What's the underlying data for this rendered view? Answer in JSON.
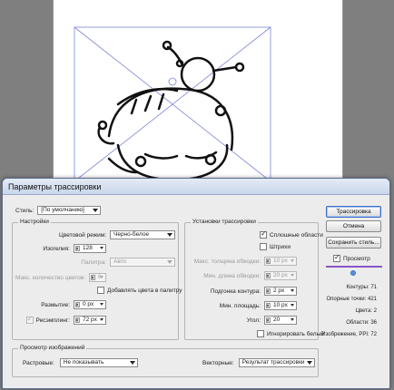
{
  "dialog": {
    "title": "Параметры трассировки"
  },
  "style": {
    "label": "Стиль:",
    "value": "[По умолчанию]"
  },
  "settings": {
    "title": "Настройки",
    "color_mode": {
      "label": "Цветовой режим:",
      "value": "Черно-белое"
    },
    "threshold": {
      "label": "Изогелия:",
      "value": "128"
    },
    "palette": {
      "label": "Палитра:",
      "value": "Авто"
    },
    "max_colors": {
      "label": "Макс. количество цветов:",
      "value": "6"
    },
    "add_swatches": {
      "label": "Добавлять цвета в палитру",
      "checked": false
    },
    "blur": {
      "label": "Размытие:",
      "value": "0 px"
    },
    "resample": {
      "label": "Ресэмплинг:",
      "value": "72 px",
      "checked": true
    }
  },
  "trace": {
    "title": "Установки трассировки",
    "fills": {
      "label": "Сплошные области",
      "checked": true
    },
    "strokes": {
      "label": "Штрихи",
      "checked": false
    },
    "max_stroke_weight": {
      "label": "Макс. толщина обводки:",
      "value": "10 px"
    },
    "min_stroke_length": {
      "label": "Мин. длина обводки:",
      "value": "20 px"
    },
    "path_fitting": {
      "label": "Подгонка контура:",
      "value": "2 px"
    },
    "min_area": {
      "label": "Мин. площадь:",
      "value": "10 px"
    },
    "corner_angle": {
      "label": "Угол:",
      "value": "20"
    },
    "ignore_white": {
      "label": "Игнорировать белый",
      "checked": false
    }
  },
  "view": {
    "title": "Просмотр изображений",
    "raster_label": "Растровые:",
    "raster_value": "Не показывать",
    "vector_label": "Векторные:",
    "vector_value": "Результат трассировки"
  },
  "buttons": {
    "trace": "Трассировка",
    "cancel": "Отмена",
    "save_preset": "Сохранить стиль..."
  },
  "preview": {
    "label": "Просмотр",
    "checked": true
  },
  "stats": [
    "Контуры: 71",
    "Опорные точки: 421",
    "Цвета: 2",
    "Области: 36",
    "Изобрежение, PPI: 72"
  ],
  "colors": {
    "accent": "#3a6ec8",
    "preview_bar": "#8a55c8",
    "selection_lines": "#7b84d9"
  }
}
